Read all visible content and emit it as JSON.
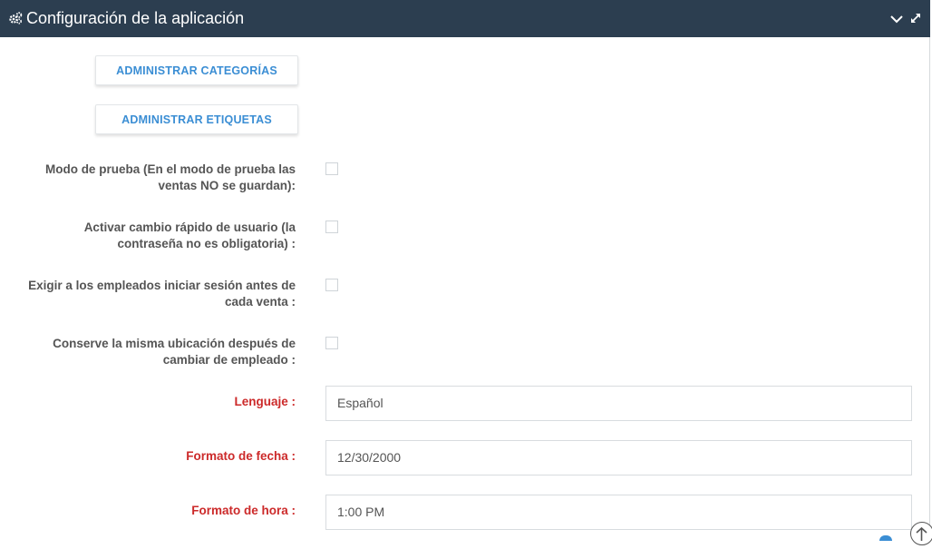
{
  "header": {
    "title": "Configuración de la aplicación",
    "icons": {
      "left": "gears-icon",
      "collapse": "chevron-down-icon",
      "expand": "expand-icon"
    }
  },
  "buttons": {
    "categories": "ADMINISTRAR CATEGORÍAS",
    "tags": "ADMINISTRAR ETIQUETAS"
  },
  "checkboxes": [
    {
      "label_line1": "Modo de prueba (En el modo de prueba las",
      "label_line2": "ventas NO se guardan):",
      "checked": false
    },
    {
      "label_line1": "Activar cambio rápido de usuario (la",
      "label_line2": "contraseña no es obligatoria) :",
      "checked": false
    },
    {
      "label_line1": "Exigir a los empleados iniciar sesión antes de",
      "label_line2": "cada venta :",
      "checked": false
    },
    {
      "label_line1": "Conserve la misma ubicación después de",
      "label_line2": "cambiar de empleado :",
      "checked": false
    }
  ],
  "selects": {
    "language": {
      "label": "Lenguaje :",
      "value": "Español"
    },
    "date_format": {
      "label": "Formato de fecha :",
      "value": "12/30/2000"
    },
    "time_format": {
      "label": "Formato de hora :",
      "value": "1:00 PM"
    }
  },
  "colors": {
    "header_bg": "#2c3e50",
    "button_text": "#3b8ed4",
    "required_label": "#cc2a2a",
    "label": "#555555"
  }
}
